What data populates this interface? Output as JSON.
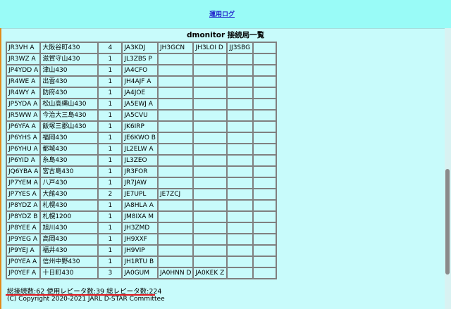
{
  "header": {
    "link_label": "運用ログ"
  },
  "page_title": "dmonitor 接続局一覧",
  "rows": [
    {
      "callsign": "JR3VH A",
      "name": "大阪谷町430",
      "count": "4",
      "stations": [
        "JA3KDJ",
        "JH3GCN",
        "JH3LOI D",
        "JJ3SBG"
      ]
    },
    {
      "callsign": "JR3WZ A",
      "name": "滋賀守山430",
      "count": "1",
      "stations": [
        "JL3ZBS P",
        "",
        "",
        ""
      ]
    },
    {
      "callsign": "JP4YDD A",
      "name": "津山430",
      "count": "1",
      "stations": [
        "JA4CFO",
        "",
        "",
        ""
      ]
    },
    {
      "callsign": "JR4WE A",
      "name": "出雲430",
      "count": "1",
      "stations": [
        "JH4AJF A",
        "",
        "",
        ""
      ]
    },
    {
      "callsign": "JR4WY A",
      "name": "防府430",
      "count": "1",
      "stations": [
        "JA4JOE",
        "",
        "",
        ""
      ]
    },
    {
      "callsign": "JP5YDA A",
      "name": "松山高縄山430",
      "count": "1",
      "stations": [
        "JA5EWJ A",
        "",
        "",
        ""
      ]
    },
    {
      "callsign": "JR5WW A",
      "name": "今治大三島430",
      "count": "1",
      "stations": [
        "JA5CVU",
        "",
        "",
        ""
      ]
    },
    {
      "callsign": "JP6YFA A",
      "name": "飯塚三郡山430",
      "count": "1",
      "stations": [
        "JK6IRP",
        "",
        "",
        ""
      ]
    },
    {
      "callsign": "JP6YHS A",
      "name": "福岡430",
      "count": "1",
      "stations": [
        "JE6KWO B",
        "",
        "",
        ""
      ]
    },
    {
      "callsign": "JP6YHU A",
      "name": "都城430",
      "count": "1",
      "stations": [
        "JL2ELW A",
        "",
        "",
        ""
      ]
    },
    {
      "callsign": "JP6YID A",
      "name": "糸島430",
      "count": "1",
      "stations": [
        "JL3ZEO",
        "",
        "",
        ""
      ]
    },
    {
      "callsign": "JQ6YBA A",
      "name": "宮古島430",
      "count": "1",
      "stations": [
        "JR3FOR",
        "",
        "",
        ""
      ]
    },
    {
      "callsign": "JP7YEM A",
      "name": "八戸430",
      "count": "1",
      "stations": [
        "JR7JAW",
        "",
        "",
        ""
      ]
    },
    {
      "callsign": "JP7YES A",
      "name": "大館430",
      "count": "2",
      "stations": [
        "JE7UPL",
        "JE7ZCJ",
        "",
        ""
      ]
    },
    {
      "callsign": "JP8YDZ A",
      "name": "札幌430",
      "count": "1",
      "stations": [
        "JA8HLA A",
        "",
        "",
        ""
      ]
    },
    {
      "callsign": "JP8YDZ B",
      "name": "札幌1200",
      "count": "1",
      "stations": [
        "JM8IXA M",
        "",
        "",
        ""
      ]
    },
    {
      "callsign": "JP8YEE A",
      "name": "旭川430",
      "count": "1",
      "stations": [
        "JH3ZMD",
        "",
        "",
        ""
      ]
    },
    {
      "callsign": "JP9YEG A",
      "name": "高岡430",
      "count": "1",
      "stations": [
        "JH9XXF",
        "",
        "",
        ""
      ]
    },
    {
      "callsign": "JP9YEJ A",
      "name": "福井430",
      "count": "1",
      "stations": [
        "JH9VIP",
        "",
        "",
        ""
      ]
    },
    {
      "callsign": "JP0YEA A",
      "name": "信州中野430",
      "count": "1",
      "stations": [
        "JH1RTU B",
        "",
        "",
        ""
      ]
    },
    {
      "callsign": "JP0YEF A",
      "name": "十日町430",
      "count": "3",
      "stations": [
        "JA0GUM",
        "JA0HNN D",
        "JA0KEK Z",
        ""
      ]
    }
  ],
  "summary": "総接続数:62 使用レピータ数:39 総レピータ数:224",
  "copyright": "(C) Copyright 2020-2021 JARL D-STAR Committee"
}
